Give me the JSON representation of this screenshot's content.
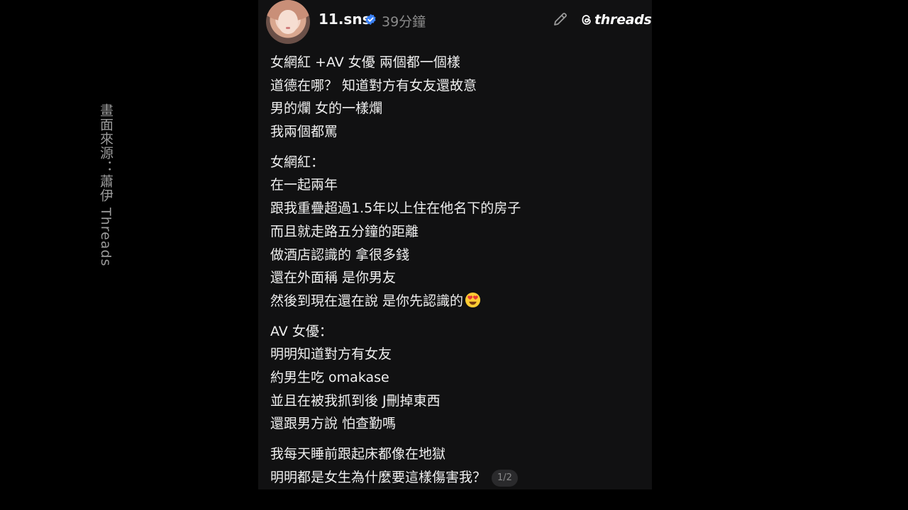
{
  "overlay": {
    "source_text": "畫面來源：蕭伊 Threads"
  },
  "header": {
    "username": "11.sns",
    "time_ago": "39分鐘",
    "brand": "threads"
  },
  "post": {
    "paragraphs": [
      [
        "女網紅 +AV 女優 兩個都一個樣",
        "道德在哪？ 知道對方有女友還故意",
        "男的爛 女的一樣爛",
        "我兩個都罵"
      ],
      [
        "女網紅：",
        "在一起兩年",
        "跟我重疊超過1.5年以上住在他名下的房子",
        "而且就走路五分鐘的距離",
        "做酒店認識的 拿很多錢",
        "還在外面稱 是你男友",
        "然後到現在還在說 是你先認識的"
      ],
      [
        "AV 女優：",
        "明明知道對方有女友",
        "約男生吃 omakase",
        "並且在被我抓到後 J刪掉東西",
        "還跟男方說 怕查勤嗎"
      ],
      [
        "我每天睡前跟起床都像在地獄",
        "明明都是女生為什麼要這樣傷害我？"
      ]
    ],
    "emoji": "heart-eyes-emoji",
    "page_indicator": "1/2"
  },
  "colors": {
    "background": "#000000",
    "card": "#111112",
    "verified": "#3b82f6",
    "muted": "#8b8b8b"
  }
}
